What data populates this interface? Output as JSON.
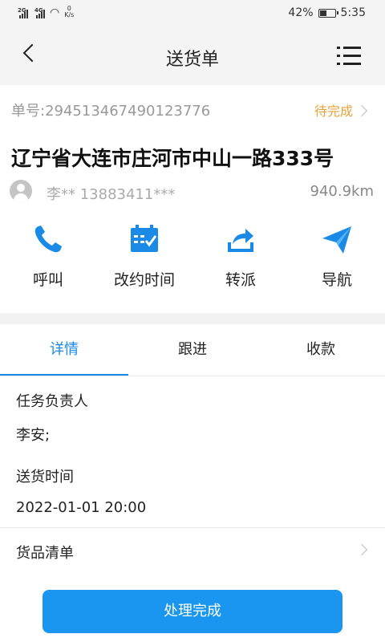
{
  "status_bar": {
    "sim1": "2G",
    "sim2": "4G",
    "net_speed_value": "0",
    "net_speed_unit": "K/s",
    "battery": "42%",
    "battery_level": 0.42,
    "time": "5:35"
  },
  "navbar": {
    "title": "送货单",
    "back_icon": "chevron-left-icon",
    "menu_icon": "list-menu-icon"
  },
  "order": {
    "number": "单号:294513467490123776",
    "status": "待完成",
    "address": "辽宁省大连市庄河市中山一路333号",
    "contact": "李** 13883411***",
    "distance": "940.9km"
  },
  "actions": [
    {
      "label": "呼叫",
      "icon": "phone-icon"
    },
    {
      "label": "改约时间",
      "icon": "calendar-check-icon"
    },
    {
      "label": "转派",
      "icon": "share-icon"
    },
    {
      "label": "导航",
      "icon": "paper-plane-icon"
    }
  ],
  "tabs": [
    {
      "label": "详情",
      "active": true
    },
    {
      "label": "跟进",
      "active": false
    },
    {
      "label": "收款",
      "active": false
    }
  ],
  "details": {
    "owner_label": "任务负责人",
    "owner_value": "李安;",
    "time_label": "送货时间",
    "time_value": "2022-01-01 20:00",
    "goods_label": "货品清单"
  },
  "colors": {
    "accent": "#1a8ae6",
    "button": "#1a96f0",
    "pending": "#e6a23c"
  },
  "submit_label": "处理完成"
}
